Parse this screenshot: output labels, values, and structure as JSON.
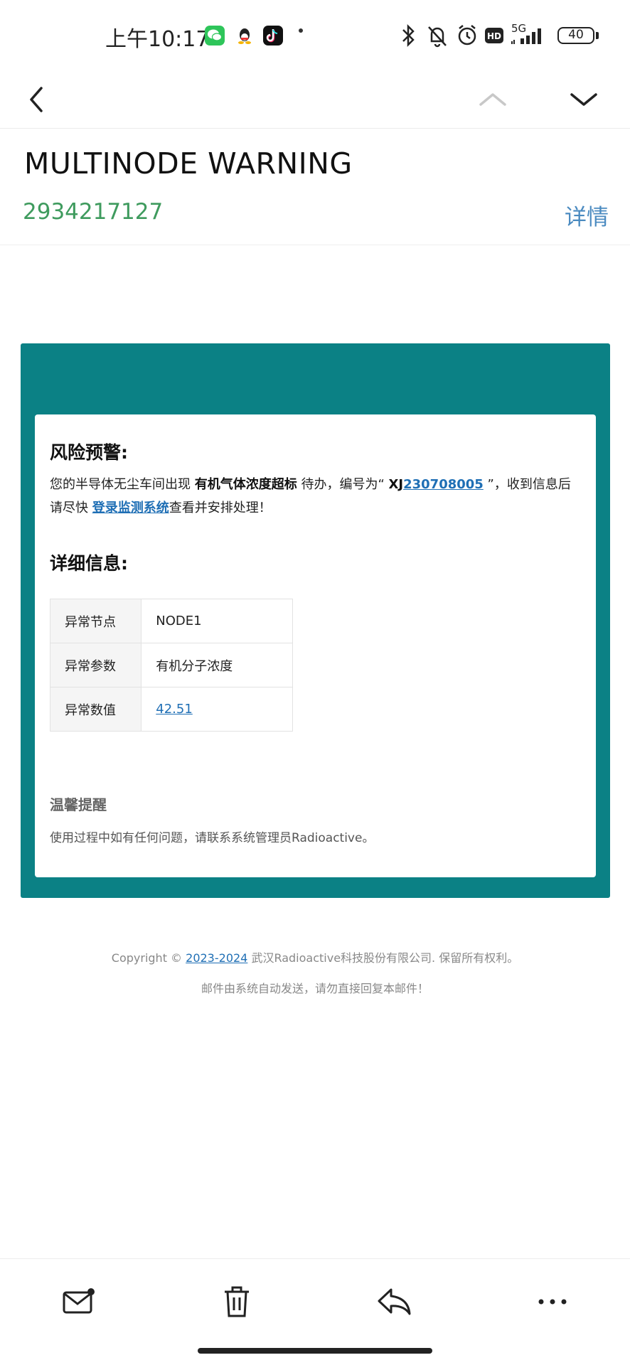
{
  "status_bar": {
    "time": "上午10:17",
    "network": "5G",
    "battery": "40",
    "icons": [
      "wechat-icon",
      "qq-icon",
      "tiktok-icon",
      "bluetooth-icon",
      "bell-muted-icon",
      "alarm-icon",
      "hd-icon",
      "signal-icon"
    ]
  },
  "nav": {
    "back_icon": "chevron-left-icon",
    "prev_icon": "chevron-up-icon",
    "next_icon": "chevron-down-icon"
  },
  "mail_header": {
    "subject": "MULTINODE WARNING",
    "sender": "2934217127",
    "details_label": "详情"
  },
  "mail_body": {
    "warning_title": "风险预警:",
    "warning_text_1": "您的半导体无尘车间出现 ",
    "warning_bold": "有机气体浓度超标",
    "warning_text_2": " 待办，编号为“ ",
    "ticket_prefix": "XJ",
    "ticket_number": "230708005",
    "warning_text_3": " ”，收到信息后请尽快 ",
    "login_link": "登录监测系统",
    "warning_text_4": "查看并安排处理！",
    "details_title": "详细信息:",
    "table": [
      {
        "label": "异常节点",
        "value": "NODE1"
      },
      {
        "label": "异常参数",
        "value": "有机分子浓度"
      },
      {
        "label": "异常数值",
        "value": "42.51"
      }
    ],
    "tip_title": "温馨提醒",
    "tip_text": "使用过程中如有任何问题，请联系系统管理员Radioactive。"
  },
  "footer": {
    "copyright_prefix": "Copyright © ",
    "years": "2023-2024",
    "company": " 武汉Radioactive科技股份有限公司. 保留所有权利。",
    "note": "邮件由系统自动发送，请勿直接回复本邮件！"
  },
  "colors": {
    "frame": "#0b8185",
    "sender": "#3f9b5e",
    "link": "#1f6fb5",
    "details": "#4a8ac0"
  },
  "bottom_bar": {
    "icons": [
      "mail-unread-icon",
      "trash-icon",
      "reply-icon",
      "more-icon"
    ]
  }
}
